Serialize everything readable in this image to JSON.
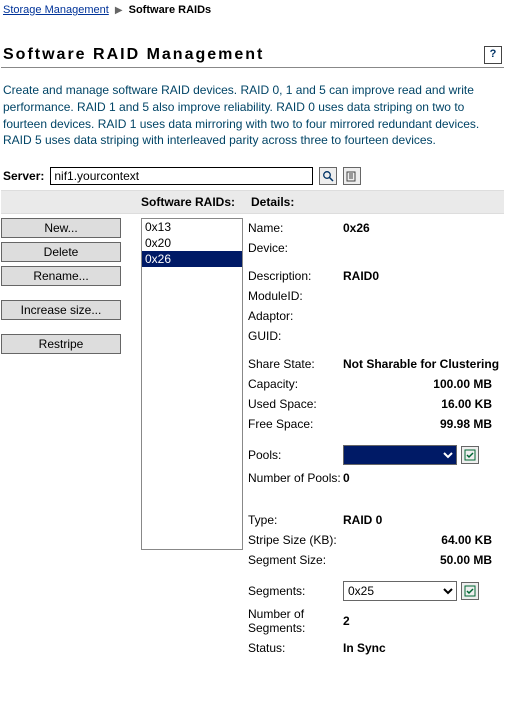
{
  "breadcrumb": {
    "parent": "Storage Management",
    "current": "Software RAIDs"
  },
  "title": "Software RAID Management",
  "description": "Create and manage software RAID devices. RAID 0, 1 and 5 can improve read and write performance. RAID 1 and 5 also improve reliability. RAID 0 uses data striping on two to fourteen devices. RAID 1 uses data mirroring with two to four mirrored redundant devices. RAID 5 uses data striping with interleaved parity across three to fourteen devices.",
  "server": {
    "label": "Server:",
    "value": "nif1.yourcontext"
  },
  "columns": {
    "raids": "Software RAIDs:",
    "details": "Details:"
  },
  "buttons": {
    "new": "New...",
    "delete": "Delete",
    "rename": "Rename...",
    "increase": "Increase size...",
    "restripe": "Restripe"
  },
  "raid_list": [
    "0x13",
    "0x20",
    "0x26"
  ],
  "selected_raid": "0x26",
  "details_labels": {
    "name": "Name:",
    "device": "Device:",
    "description": "Description:",
    "moduleid": "ModuleID:",
    "adaptor": "Adaptor:",
    "guid": "GUID:",
    "share_state": "Share State:",
    "capacity": "Capacity:",
    "used_space": "Used Space:",
    "free_space": "Free Space:",
    "pools": "Pools:",
    "num_pools": "Number of Pools:",
    "type": "Type:",
    "stripe_size": "Stripe Size (KB):",
    "segment_size": "Segment Size:",
    "segments": "Segments:",
    "num_segments": "Number of Segments:",
    "status": "Status:"
  },
  "details_values": {
    "name": "0x26",
    "device": "",
    "description": "RAID0",
    "moduleid": "",
    "adaptor": "",
    "guid": "",
    "share_state": "Not Sharable for Clustering",
    "capacity": "100.00 MB",
    "used_space": "16.00 KB",
    "free_space": "99.98 MB",
    "pools_selected": "",
    "num_pools": "0",
    "type": "RAID 0",
    "stripe_size": "64.00 KB",
    "segment_size": "50.00 MB",
    "segments_selected": "0x25",
    "num_segments": "2",
    "status": "In Sync"
  }
}
